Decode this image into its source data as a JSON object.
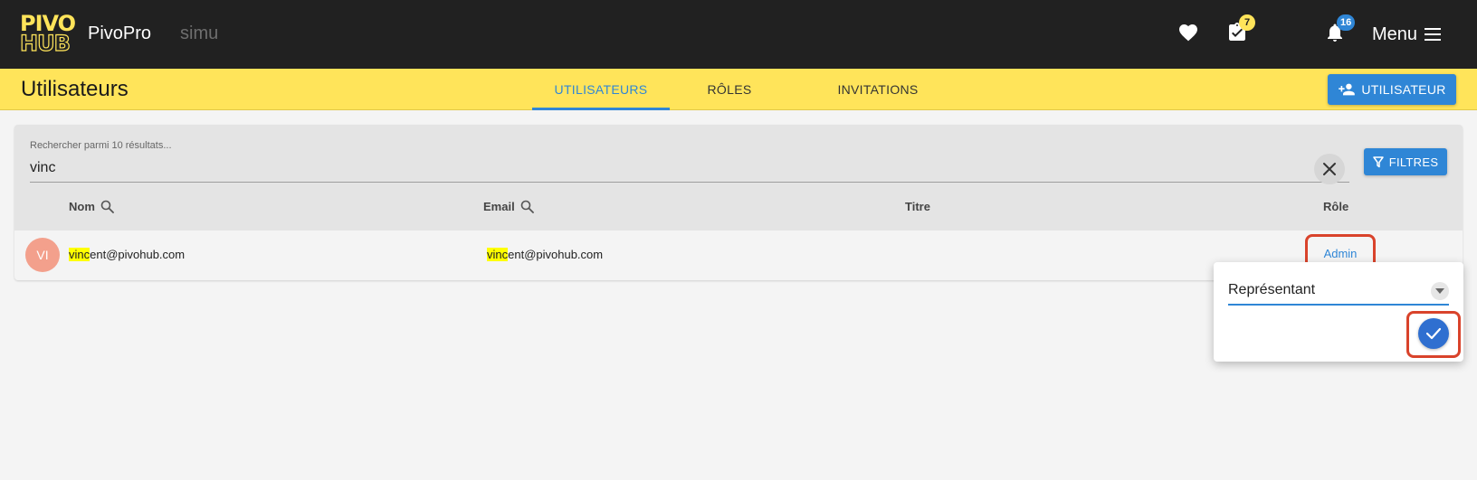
{
  "topbar": {
    "logo": {
      "line1": "PIVO",
      "line2": "HUB"
    },
    "app_name": "PivoPro",
    "environment": "simu",
    "tasks_badge": "7",
    "notifications_badge": "16",
    "menu_label": "Menu",
    "icons": [
      "heart-icon",
      "tasks-check-icon",
      "bell-icon",
      "hamburger-icon"
    ]
  },
  "header": {
    "title": "Utilisateurs",
    "tabs": [
      {
        "label": "UTILISATEURS",
        "active": true
      },
      {
        "label": "RÔLES",
        "active": false
      },
      {
        "label": "INVITATIONS",
        "active": false
      }
    ],
    "add_user_label": "UTILISATEUR"
  },
  "search": {
    "label": "Rechercher parmi 10 résultats...",
    "value": "vinc",
    "filters_label": "FILTRES"
  },
  "table": {
    "columns": [
      "Nom",
      "Email",
      "Titre",
      "Rôle"
    ],
    "rows": [
      {
        "avatar": "VI",
        "name_highlight": "vinc",
        "name_rest": "ent@pivohub.com",
        "email_highlight": "vinc",
        "email_rest": "ent@pivohub.com",
        "title": "",
        "role": "Admin"
      }
    ]
  },
  "role_popover": {
    "selected": "Représentant"
  },
  "colors": {
    "topbar": "#212121",
    "accent_yellow": "#ffe45a",
    "primary_blue": "#2f86d6",
    "annotation_red": "#d9432b",
    "highlight": "#ffff00"
  }
}
